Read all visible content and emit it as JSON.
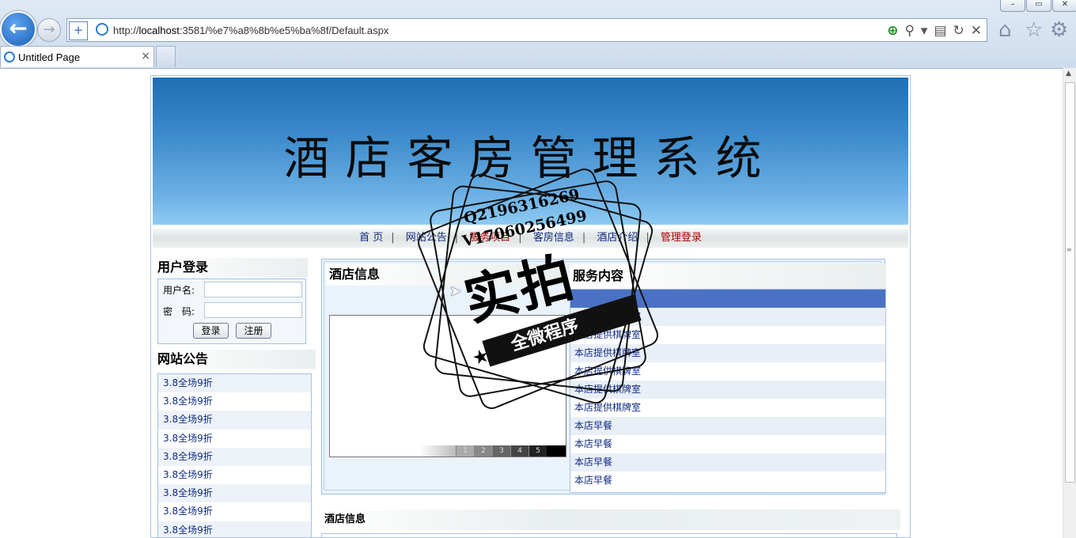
{
  "browser": {
    "url_prefix": "http://",
    "url_host": "localhost",
    "url_rest": ":3581/%e7%a8%8b%e5%ba%8f/Default.aspx",
    "tab_title": "Untitled Page",
    "tab_close": "×",
    "window_buttons": [
      "–",
      "▭",
      "✕"
    ]
  },
  "site": {
    "title": "酒店客房管理系统",
    "nav": [
      {
        "label": "首 页",
        "color": "#102b80"
      },
      {
        "label": "网站公告",
        "color": "#102b80"
      },
      {
        "label": "服务项目",
        "color": "#b00000"
      },
      {
        "label": "客房信息",
        "color": "#102b80"
      },
      {
        "label": "酒店介绍",
        "color": "#102b80"
      },
      {
        "label": "管理登录",
        "color": "#b00000"
      }
    ],
    "nav_separator": "|"
  },
  "login": {
    "title": "用户登录",
    "username_label": "用户名:",
    "password_label": "密　码:",
    "login_button": "登录",
    "register_button": "注册"
  },
  "notice": {
    "title": "网站公告",
    "items": [
      "3.8全场9折",
      "3.8全场9折",
      "3.8全场9折",
      "3.8全场9折",
      "3.8全场9折",
      "3.8全场9折",
      "3.8全场9折",
      "3.8全场9折",
      "3.8全场9折"
    ]
  },
  "hotel": {
    "title": "酒店信息",
    "slide_numbers": [
      "1",
      "2",
      "3",
      "4",
      "5"
    ]
  },
  "services": {
    "title": "服务内容",
    "items": [
      "本店提供棋牌室",
      "本店提供棋牌室",
      "本店提供棋牌室",
      "本店提供棋牌室",
      "本店提供棋牌室",
      "本店提供棋牌室",
      "本店早餐",
      "本店早餐",
      "本店早餐",
      "本店早餐"
    ]
  },
  "bottom": {
    "title": "酒店信息"
  },
  "watermark": {
    "line1": "Q2196316269",
    "line2": "V17060256499",
    "big": "实拍",
    "ribbon": "全微程序"
  }
}
